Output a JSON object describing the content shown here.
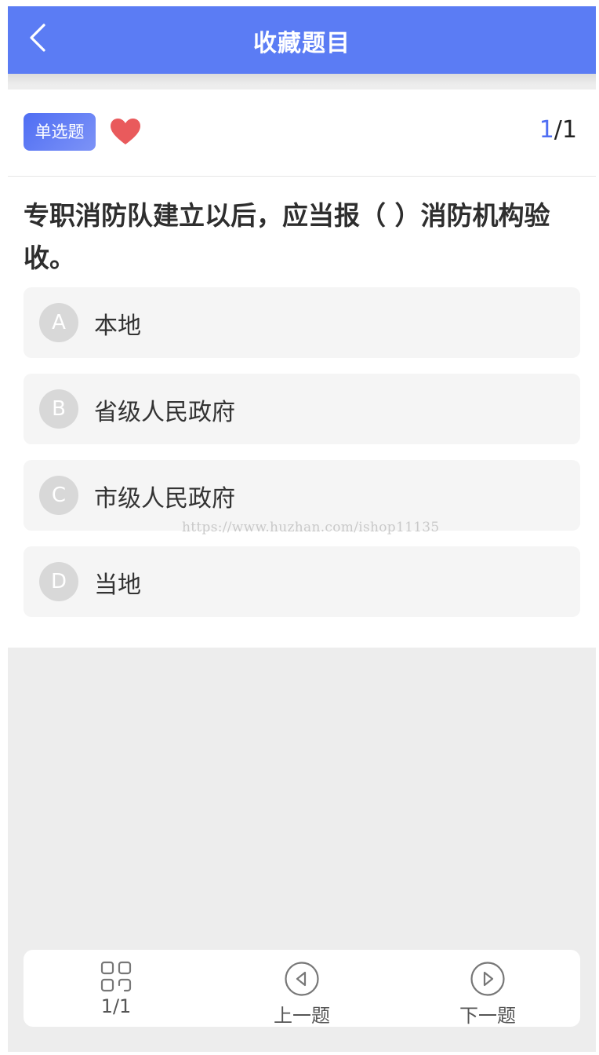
{
  "header": {
    "title": "收藏题目"
  },
  "question": {
    "type_badge": "单选题",
    "favorited": true,
    "current": "1",
    "separator": "/",
    "total": "1",
    "text": "专职消防队建立以后，应当报（ ）消防机构验收。",
    "options": [
      {
        "letter": "A",
        "text": "本地"
      },
      {
        "letter": "B",
        "text": "省级人民政府"
      },
      {
        "letter": "C",
        "text": "市级人民政府"
      },
      {
        "letter": "D",
        "text": "当地"
      }
    ]
  },
  "watermark": "https://www.huzhan.com/ishop11135",
  "bottom_bar": {
    "index_label": "1/1",
    "prev_label": "上一题",
    "next_label": "下一题"
  },
  "colors": {
    "accent": "#5b7cf4",
    "heart": "#e95a5c",
    "option_bg": "#f5f5f5"
  }
}
